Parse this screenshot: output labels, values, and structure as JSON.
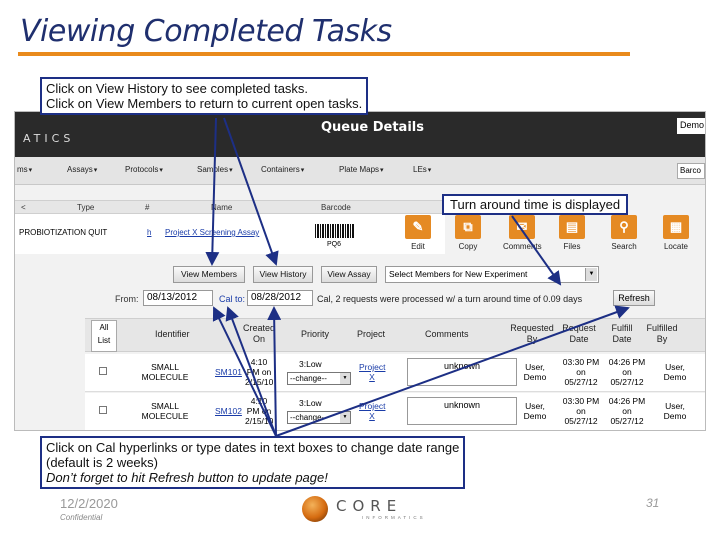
{
  "slide": {
    "title": "Viewing Completed Tasks",
    "accent_color": "#e98a1c",
    "title_color": "#1f2f6e",
    "callout_border_color": "#1d2f85"
  },
  "callouts": {
    "history": {
      "line1": "Click on View History to see completed tasks.",
      "line2": "Click on View Members to return to current open tasks."
    },
    "turnaround": "Turn around time is displayed",
    "date_range": {
      "line1": "Click on Cal hyperlinks or type dates in text boxes to change date range",
      "line2": "(default is 2 weeks)",
      "line3": "Don’t forget to hit Refresh button to update page!"
    }
  },
  "app": {
    "brand": "ATICS",
    "page_title": "Queue Details",
    "user_label": "Demo",
    "barcode_box": "Barco",
    "menu": [
      {
        "label": "ms"
      },
      {
        "label": "Assays"
      },
      {
        "label": "Protocols"
      },
      {
        "label": "Samples"
      },
      {
        "label": "Containers"
      },
      {
        "label": "Plate Maps"
      },
      {
        "label": "LEs"
      }
    ],
    "grid": {
      "headers": {
        "nav": "<",
        "type": "Type",
        "num": "#",
        "name": "Name",
        "barcode": "Barcode"
      },
      "row": {
        "type": "PROBIOTIZATION QUIT",
        "num": "h",
        "name": "Project X Screening Assay",
        "barcode": "PQ6"
      }
    },
    "tools": [
      {
        "label": "Edit",
        "icon": "pencil-icon",
        "color": "#e58a23"
      },
      {
        "label": "Copy",
        "icon": "copy-icon",
        "color": "#e58a23"
      },
      {
        "label": "Comments",
        "icon": "comment-icon",
        "color": "#e58a23"
      },
      {
        "label": "Files",
        "icon": "file-icon",
        "color": "#e58a23"
      },
      {
        "label": "Search",
        "icon": "search-icon",
        "color": "#e58a23"
      },
      {
        "label": "Locate",
        "icon": "building-icon",
        "color": "#e58a23"
      }
    ],
    "buttons": {
      "view_members": "View Members",
      "view_history": "View History",
      "view_assay": "View Assay",
      "select_members": "Select Members for New Experiment"
    },
    "dates": {
      "from_label": "From:",
      "from_value": "08/13/2012",
      "to_label": "Cal to:",
      "to_value": "08/28/2012",
      "summary": "Cal, 2 requests were processed w/ a turn around time of 0.09 days",
      "refresh": "Refresh"
    },
    "requests": {
      "all_label": "All",
      "list_label": "List",
      "headers": {
        "identifier": "Identifier",
        "created": "Created On",
        "priority": "Priority",
        "project": "Project",
        "comments": "Comments",
        "requested_by": "Requested By",
        "request_date": "Request Date",
        "fulfill_date": "Fulfill Date",
        "fulfilled_by": "Fulfilled By"
      },
      "rows": [
        {
          "identifier": "SMALL MOLECULE",
          "id_link": "SM101",
          "created": "4:10 PM on 2/15/10",
          "priority": "3:Low",
          "priority_select": "--change--",
          "project": "Project X",
          "comment": "unknown",
          "requested_by": "User, Demo",
          "request_date": "03:30 PM on 05/27/12",
          "fulfill_date": "04:26 PM on 05/27/12",
          "fulfilled_by": "User, Demo"
        },
        {
          "identifier": "SMALL MOLECULE",
          "id_link": "SM102",
          "created": "4:10 PM on 2/15/10",
          "priority": "3:Low",
          "priority_select": "--change--",
          "project": "Project X",
          "comment": "unknown",
          "requested_by": "User, Demo",
          "request_date": "03:30 PM on 05/27/12",
          "fulfill_date": "04:26 PM on 05/27/12",
          "fulfilled_by": "User, Demo"
        }
      ]
    }
  },
  "footer": {
    "date": "12/2/2020",
    "confidential": "Confidential",
    "page": "31",
    "logo_word": "CORE",
    "logo_sub": "INFORMATICS"
  }
}
